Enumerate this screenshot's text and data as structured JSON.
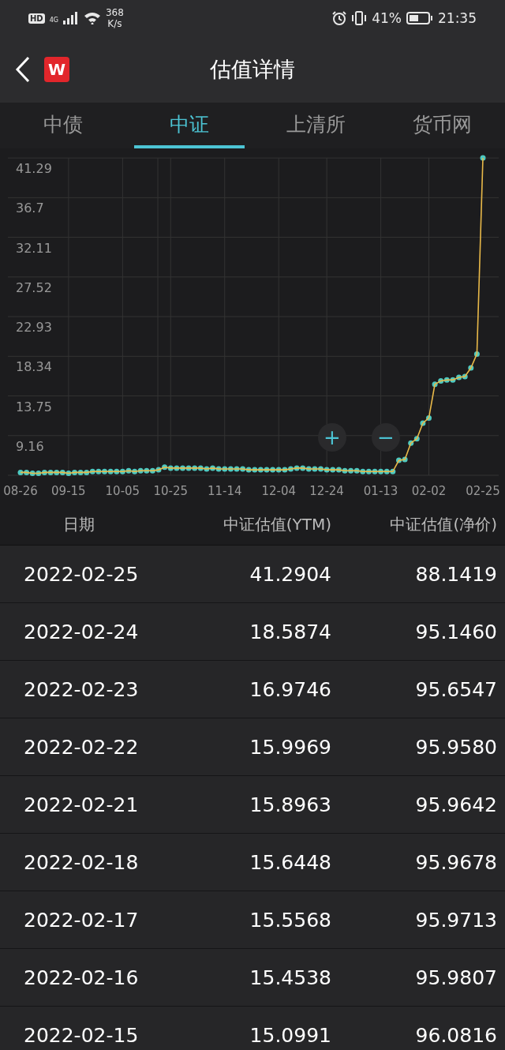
{
  "status_bar": {
    "hd": "HD",
    "network": "4G",
    "speed_value": "368",
    "speed_unit": "K/s",
    "battery": "41%",
    "time": "21:35"
  },
  "header": {
    "title": "估值详情",
    "logo": "W"
  },
  "tabs": [
    {
      "label": "中债",
      "selected": false
    },
    {
      "label": "中证",
      "selected": true
    },
    {
      "label": "上清所",
      "selected": false
    },
    {
      "label": "货币网",
      "selected": false
    }
  ],
  "chart": {
    "chart_data": {
      "type": "line",
      "categories": [
        "08-26",
        null,
        null,
        null,
        null,
        null,
        null,
        null,
        "09-15",
        null,
        null,
        null,
        null,
        null,
        null,
        null,
        null,
        "10-05",
        null,
        null,
        null,
        null,
        null,
        null,
        null,
        "10-25",
        null,
        null,
        null,
        null,
        null,
        null,
        null,
        null,
        "11-14",
        null,
        null,
        null,
        null,
        null,
        null,
        null,
        null,
        "12-04",
        null,
        null,
        null,
        null,
        null,
        null,
        null,
        "12-24",
        null,
        null,
        null,
        null,
        null,
        null,
        null,
        null,
        "01-13",
        null,
        null,
        null,
        null,
        null,
        null,
        null,
        "02-02",
        null,
        null,
        null,
        null,
        null,
        null,
        null,
        null,
        "02-25"
      ],
      "series": [
        {
          "color": "#e9b949",
          "marker": true,
          "values": [
            4.9,
            4.9,
            4.8,
            4.8,
            4.9,
            4.9,
            4.9,
            4.9,
            4.8,
            4.9,
            4.9,
            4.9,
            5.0,
            5.0,
            5.0,
            5.0,
            5.0,
            5.0,
            5.1,
            5.0,
            5.1,
            5.1,
            5.1,
            5.2,
            5.5,
            5.4,
            5.4,
            5.4,
            5.4,
            5.4,
            5.4,
            5.3,
            5.4,
            5.3,
            5.3,
            5.3,
            5.3,
            5.3,
            5.2,
            5.2,
            5.2,
            5.2,
            5.2,
            5.2,
            5.2,
            5.3,
            5.4,
            5.4,
            5.3,
            5.3,
            5.3,
            5.2,
            5.2,
            5.2,
            5.1,
            5.1,
            5.1,
            5.0,
            5.0,
            5.0,
            5.0,
            5.0,
            5.0,
            6.3,
            6.4,
            8.3,
            8.8,
            10.6,
            11.2,
            15.1,
            15.5,
            15.6,
            15.6,
            15.9,
            16.0,
            17.0,
            18.6,
            41.3
          ]
        }
      ],
      "ylim": [
        4.57,
        41.3
      ],
      "grid": true,
      "yticks": [
        9.16,
        13.75,
        18.34,
        22.93,
        27.52,
        32.11,
        36.7,
        41.29
      ]
    },
    "zoom_in": "+",
    "zoom_out": "−"
  },
  "table": {
    "columns": [
      "日期",
      "中证估值(YTM)",
      "中证估值(净价)"
    ],
    "rows": [
      [
        "2022-02-25",
        "41.2904",
        "88.1419"
      ],
      [
        "2022-02-24",
        "18.5874",
        "95.1460"
      ],
      [
        "2022-02-23",
        "16.9746",
        "95.6547"
      ],
      [
        "2022-02-22",
        "15.9969",
        "95.9580"
      ],
      [
        "2022-02-21",
        "15.8963",
        "95.9642"
      ],
      [
        "2022-02-18",
        "15.6448",
        "95.9678"
      ],
      [
        "2022-02-17",
        "15.5568",
        "95.9713"
      ],
      [
        "2022-02-16",
        "15.4538",
        "95.9807"
      ],
      [
        "2022-02-15",
        "15.0991",
        "96.0816"
      ]
    ]
  }
}
